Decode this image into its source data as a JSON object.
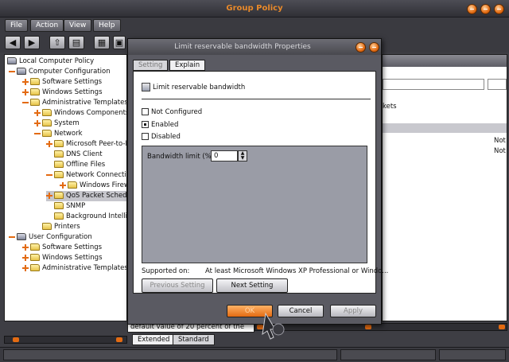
{
  "window": {
    "title": "Group Policy"
  },
  "menu": [
    "File",
    "Action",
    "View",
    "Help"
  ],
  "toolbar": {
    "icons": [
      "back-arrow-icon",
      "forward-arrow-icon",
      "folder-up-icon",
      "show-hide-tree-icon",
      "properties-icon",
      "export-icon"
    ]
  },
  "tree": {
    "nodes": [
      {
        "label": "Local Computer Policy",
        "icon": "policy-icon"
      },
      {
        "label": "Computer Configuration",
        "icon": "computer-icon"
      },
      {
        "label": "Software Settings",
        "icon": "folder-icon"
      },
      {
        "label": "Windows Settings",
        "icon": "folder-icon"
      },
      {
        "label": "Administrative Templates",
        "icon": "folder-icon"
      },
      {
        "label": "Windows Components",
        "icon": "folder-icon"
      },
      {
        "label": "System",
        "icon": "folder-icon"
      },
      {
        "label": "Network",
        "icon": "folder-icon"
      },
      {
        "label": "Microsoft Peer-to-Pe",
        "icon": "folder-icon"
      },
      {
        "label": "DNS Client",
        "icon": "folder-icon"
      },
      {
        "label": "Offline Files",
        "icon": "folder-icon"
      },
      {
        "label": "Network Connection",
        "icon": "folder-icon"
      },
      {
        "label": "Windows Firew",
        "icon": "folder-icon"
      },
      {
        "label": "QoS Packet Schedu",
        "icon": "folder-icon"
      },
      {
        "label": "SNMP",
        "icon": "folder-icon"
      },
      {
        "label": "Background Intellig",
        "icon": "folder-icon"
      },
      {
        "label": "Printers",
        "icon": "folder-icon"
      },
      {
        "label": "User Configuration",
        "icon": "user-icon"
      },
      {
        "label": "Software Settings",
        "icon": "folder-icon"
      },
      {
        "label": "Windows Settings",
        "icon": "folder-icon"
      },
      {
        "label": "Administrative Templates",
        "icon": "folder-icon"
      }
    ]
  },
  "right_panel": {
    "text_kets": "kets",
    "row1_state": "Not",
    "row2_state": "Not"
  },
  "description_strip": "default value of 20 percent of the",
  "view_tabs": {
    "extended": "Extended",
    "standard": "Standard"
  },
  "dialog": {
    "title": "Limit reservable bandwidth Properties",
    "tabs": {
      "setting": "Setting",
      "explain": "Explain"
    },
    "policy_name": "Limit reservable bandwidth",
    "options": {
      "not_configured": "Not Configured",
      "enabled": "Enabled",
      "disabled": "Disabled"
    },
    "bandwidth_label": "Bandwidth limit (%):",
    "bandwidth_value": "0",
    "supported_label": "Supported on:",
    "supported_value": "At least Microsoft Windows XP Professional or Windo...",
    "previous_setting": "Previous Setting",
    "next_setting": "Next Setting",
    "ok": "OK",
    "cancel": "Cancel",
    "apply": "Apply"
  },
  "colors": {
    "accent": "#e36b12",
    "title": "#e8892a",
    "chrome": "#3e3e44"
  }
}
